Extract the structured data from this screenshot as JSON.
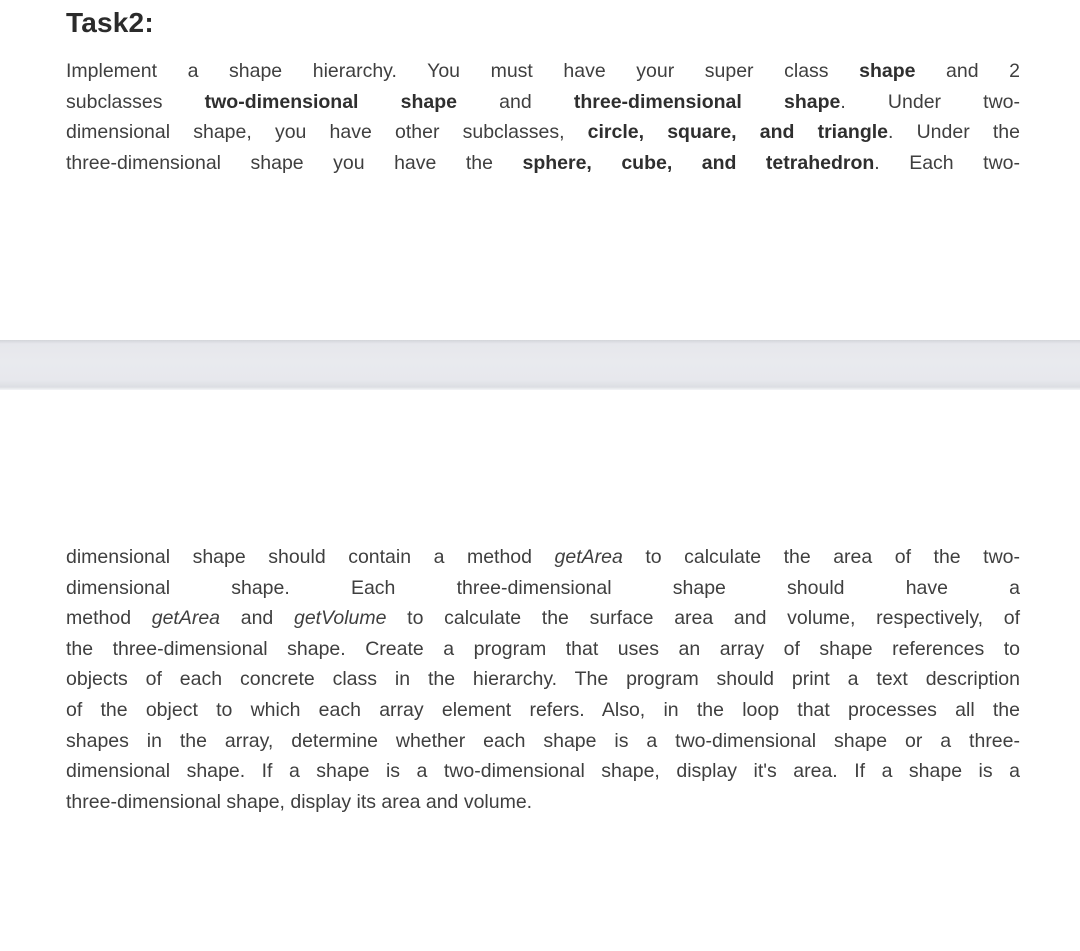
{
  "document": {
    "title": "Task2:",
    "background_color": "#ffffff",
    "text_color": "#3f3f3f",
    "separator_band_color": "#e9eaee"
  },
  "paragraph_1": {
    "line_1": {
      "seg_1": "Implement a shape hierarchy. You must have your super class ",
      "seg_2_bold": "shape",
      "seg_3": " and 2"
    },
    "line_2": {
      "seg_1": "subclasses ",
      "seg_2_bold": "two-dimensional",
      "seg_3": "    ",
      "seg_4_bold": "shape",
      "seg_5": " and ",
      "seg_6_bold": "three-dimensional",
      "seg_7": "   ",
      "seg_8_bold": "shape",
      "seg_9": ".   Under    two-"
    },
    "line_3": {
      "seg_1": "dimensional shape, you have other subclasses, ",
      "seg_2_bold": "circle, square, and triangle",
      "seg_3": ". Under the"
    },
    "line_4": {
      "seg_1": "three-dimensional shape you have the ",
      "seg_2_bold": "sphere, cube, and tetrahedron",
      "seg_3": ". Each two-"
    },
    "full_text": "Implement a shape hierarchy. You must have your super class shape and 2 subclasses two-dimensional shape and three-dimensional shape. Under two-dimensional shape, you have other subclasses, circle, square, and triangle. Under the three-dimensional shape you have the sphere, cube, and tetrahedron. Each two-"
  },
  "paragraph_2": {
    "line_1": {
      "seg_1": "dimensional shape should contain a method ",
      "seg_2_italic": "getArea",
      "seg_3": " to calculate the area of the two-"
    },
    "line_2": {
      "seg_1": "dimensional   shape.   Each   three-dimensional   shape   should   have   a"
    },
    "line_3": {
      "seg_1": "method ",
      "seg_2_italic": "getArea",
      "seg_3": " and ",
      "seg_4_italic": "getVolume",
      "seg_5": " to calculate the surface area and volume, respectively, of"
    },
    "line_4": {
      "seg_1": "the three-dimensional shape. Create a program that uses an array of shape references to"
    },
    "line_5": {
      "seg_1": "objects of each concrete class in the hierarchy. The program should print a text description"
    },
    "line_6": {
      "seg_1": "of the object to which each array element refers. Also, in the loop that processes all the"
    },
    "line_7": {
      "seg_1": "shapes in the array, determine whether each shape is a two-dimensional shape or a three-"
    },
    "line_8": {
      "seg_1": "dimensional shape. If a shape is a two-dimensional shape, display it's area. If a shape is a"
    },
    "line_9": {
      "seg_1": "three-dimensional shape, display its area and volume."
    },
    "full_text": "dimensional shape should contain a method getArea to calculate the area of the two-dimensional shape. Each three-dimensional shape should have a method getArea and getVolume to calculate the surface area and volume, respectively, of the three-dimensional shape. Create a program that uses an array of shape references to objects of each concrete class in the hierarchy. The program should print a text description of the object to which each array element refers. Also, in the loop that processes all the shapes in the array, determine whether each shape is a two-dimensional shape or a three-dimensional shape. If a shape is a two-dimensional shape, display it's area. If a shape is a three-dimensional shape, display its area and volume."
  }
}
